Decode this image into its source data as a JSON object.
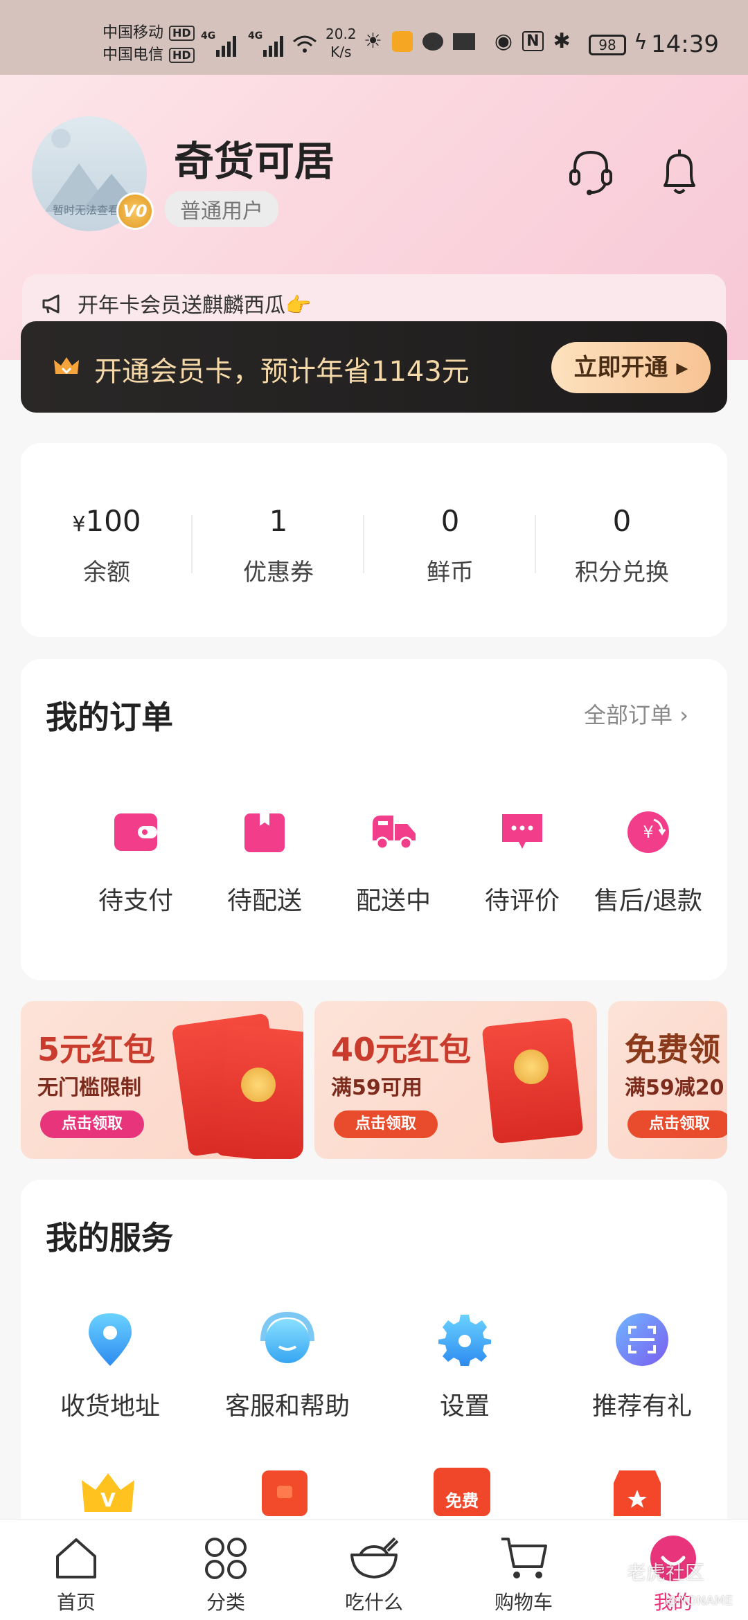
{
  "status_bar": {
    "carrier1": "中国移动",
    "carrier2": "中国电信",
    "hd": "HD",
    "net1": "4G",
    "net2": "4G",
    "speed_value": "20.2",
    "speed_unit": "K/s",
    "battery": "98",
    "time": "14:39"
  },
  "profile": {
    "avatar_placeholder": "暂时无法查看",
    "vip_level": "V0",
    "username": "奇货可居",
    "user_level": "普通用户",
    "icons": [
      "headset-icon",
      "bell-icon"
    ]
  },
  "promo": {
    "text": "开年卡会员送麒麟西瓜👉"
  },
  "member_card": {
    "text": "开通会员卡，预计年省1143元",
    "button": "立即开通"
  },
  "assets": [
    {
      "currency": "¥",
      "value": "100",
      "label": "余额"
    },
    {
      "currency": "",
      "value": "1",
      "label": "优惠券"
    },
    {
      "currency": "",
      "value": "0",
      "label": "鲜币"
    },
    {
      "currency": "",
      "value": "0",
      "label": "积分兑换"
    }
  ],
  "orders": {
    "title": "我的订单",
    "all_link": "全部订单",
    "items": [
      {
        "label": "待支付",
        "icon": "wallet-icon"
      },
      {
        "label": "待配送",
        "icon": "package-icon"
      },
      {
        "label": "配送中",
        "icon": "delivery-truck-icon"
      },
      {
        "label": "待评价",
        "icon": "comment-icon"
      },
      {
        "label": "售后/退款",
        "icon": "refund-icon"
      }
    ]
  },
  "coupons": [
    {
      "title": "5元红包",
      "subtitle": "无门槛限制",
      "button": "点击领取"
    },
    {
      "title": "40元红包",
      "subtitle": "满59可用",
      "button": "点击领取"
    },
    {
      "title": "免费领",
      "subtitle": "满59减20",
      "button": "点击领取"
    }
  ],
  "services": {
    "title": "我的服务",
    "items": [
      {
        "label": "收货地址",
        "icon": "location-pin-icon"
      },
      {
        "label": "客服和帮助",
        "icon": "customer-service-icon"
      },
      {
        "label": "设置",
        "icon": "gear-icon"
      },
      {
        "label": "推荐有礼",
        "icon": "scan-icon"
      }
    ],
    "row2_icons": [
      "vip-crown-icon",
      "red-envelope-icon",
      "free-tag-icon",
      "store-star-icon"
    ],
    "free_tag": "免费"
  },
  "tabbar": {
    "items": [
      {
        "label": "首页",
        "icon": "home-icon"
      },
      {
        "label": "分类",
        "icon": "category-icon"
      },
      {
        "label": "吃什么",
        "icon": "bowl-icon"
      },
      {
        "label": "购物车",
        "icon": "cart-icon"
      },
      {
        "label": "我的",
        "icon": "profile-smile-icon"
      }
    ],
    "active": "我的"
  },
  "watermark": {
    "text": "老虎社区",
    "sub": "@NONAME"
  },
  "colors": {
    "accent": "#e8347a",
    "icon_pink": "#f23d8a",
    "member_gold": "#f6d9a8"
  }
}
